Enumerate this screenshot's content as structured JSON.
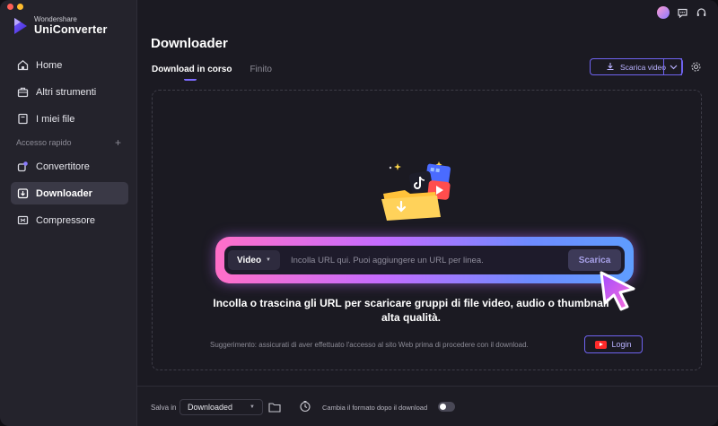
{
  "app": {
    "brand_small": "Wondershare",
    "brand_name": "UniConverter"
  },
  "sidebar": {
    "items": [
      {
        "label": "Home",
        "icon": "home-icon"
      },
      {
        "label": "Altri strumenti",
        "icon": "toolbox-icon"
      },
      {
        "label": "I miei file",
        "icon": "file-icon"
      }
    ],
    "quick_access_label": "Accesso rapido",
    "quick_items": [
      {
        "label": "Convertitore",
        "icon": "converter-icon"
      },
      {
        "label": "Downloader",
        "icon": "downloader-icon",
        "active": true
      },
      {
        "label": "Compressore",
        "icon": "compressor-icon"
      }
    ]
  },
  "header": {
    "title": "Downloader",
    "tabs": [
      {
        "label": "Download in corso",
        "active": true
      },
      {
        "label": "Finito",
        "active": false
      }
    ],
    "download_button": "Scarica video"
  },
  "url_bar": {
    "type_label": "Video",
    "placeholder": "Incolla URL qui. Puoi aggiungere un URL per linea.",
    "submit_label": "Scarica"
  },
  "content": {
    "main_message": "Incolla o trascina gli URL per scaricare gruppi di file video, audio o thumbnail alta qualità.",
    "hint": "Suggerimento: assicurati di aver effettuato l'accesso al sito Web prima di procedere con il download.",
    "login_label": "Login"
  },
  "bottom": {
    "save_in_label": "Salva in",
    "save_in_value": "Downloaded",
    "convert_label": "Cambia il formato dopo il download",
    "convert_toggle_on": false
  },
  "colors": {
    "accent": "#7c6bff",
    "sidebar_bg": "#24232c",
    "main_bg": "#1b1a22"
  }
}
